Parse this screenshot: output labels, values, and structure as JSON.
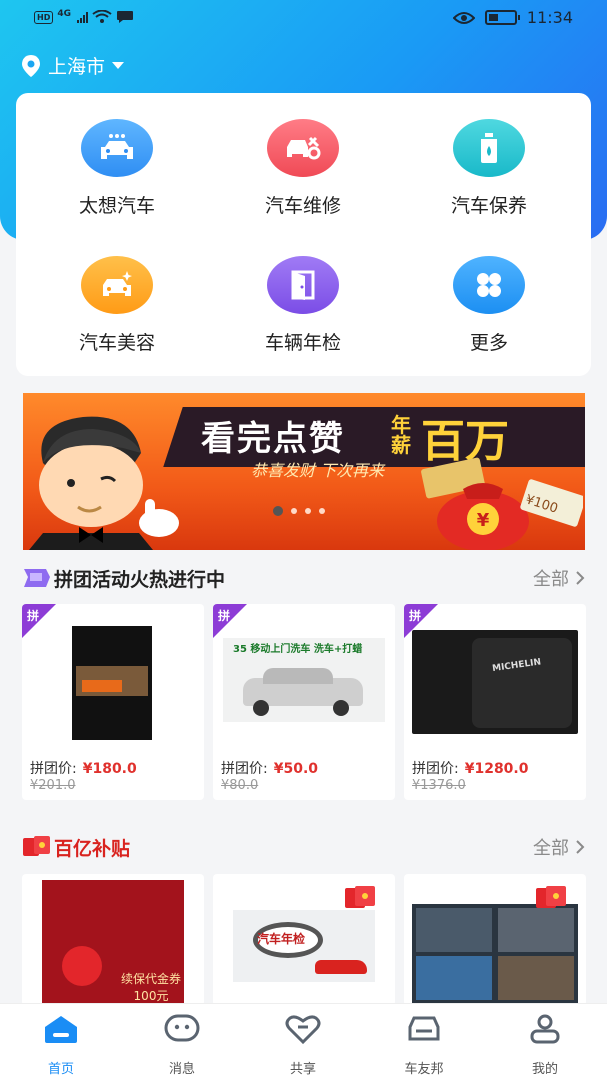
{
  "status": {
    "network": "4G",
    "hd": "HD",
    "time": "11:34"
  },
  "location": {
    "city": "上海市"
  },
  "services": [
    {
      "label": "太想汽车",
      "icon": "car-icon",
      "color": "#2f8ef3"
    },
    {
      "label": "汽车维修",
      "icon": "repair-icon",
      "color": "#f04a56"
    },
    {
      "label": "汽车保养",
      "icon": "oil-icon",
      "color": "#19b9c9"
    },
    {
      "label": "汽车美容",
      "icon": "car-sparkle-icon",
      "color": "#ff9b16"
    },
    {
      "label": "车辆年检",
      "icon": "door-icon",
      "color": "#7b4de6"
    },
    {
      "label": "更多",
      "icon": "grid-icon",
      "color": "#1c8ff2"
    }
  ],
  "banner": {
    "headline": "看完点赞",
    "sub_small": "年薪",
    "big": "百万",
    "slogan": "恭喜发财  下次再来",
    "badge_amount": "¥100"
  },
  "group_buy": {
    "title": "拼团活动火热进行中",
    "more": "全部",
    "tag": "拼",
    "price_label": "拼团价:",
    "items": [
      {
        "price": "¥180.0",
        "original": "¥201.0"
      },
      {
        "price": "¥50.0",
        "original": "¥80.0",
        "image_text": "35 移动上门洗车 洗车+打蜡"
      },
      {
        "price": "¥1280.0",
        "original": "¥1376.0",
        "image_text": "MICHELIN"
      }
    ]
  },
  "subsidy": {
    "title": "百亿补贴",
    "more": "全部",
    "items": [
      {
        "image_text": "续保代金券 100元"
      },
      {
        "image_text": "汽车年检"
      },
      {
        "image_text": ""
      }
    ]
  },
  "tabbar": [
    {
      "label": "首页",
      "icon": "home-icon",
      "active": true
    },
    {
      "label": "消息",
      "icon": "message-icon",
      "active": false
    },
    {
      "label": "共享",
      "icon": "heart-icon",
      "active": false
    },
    {
      "label": "车友邦",
      "icon": "car-front-icon",
      "active": false
    },
    {
      "label": "我的",
      "icon": "user-icon",
      "active": false
    }
  ]
}
